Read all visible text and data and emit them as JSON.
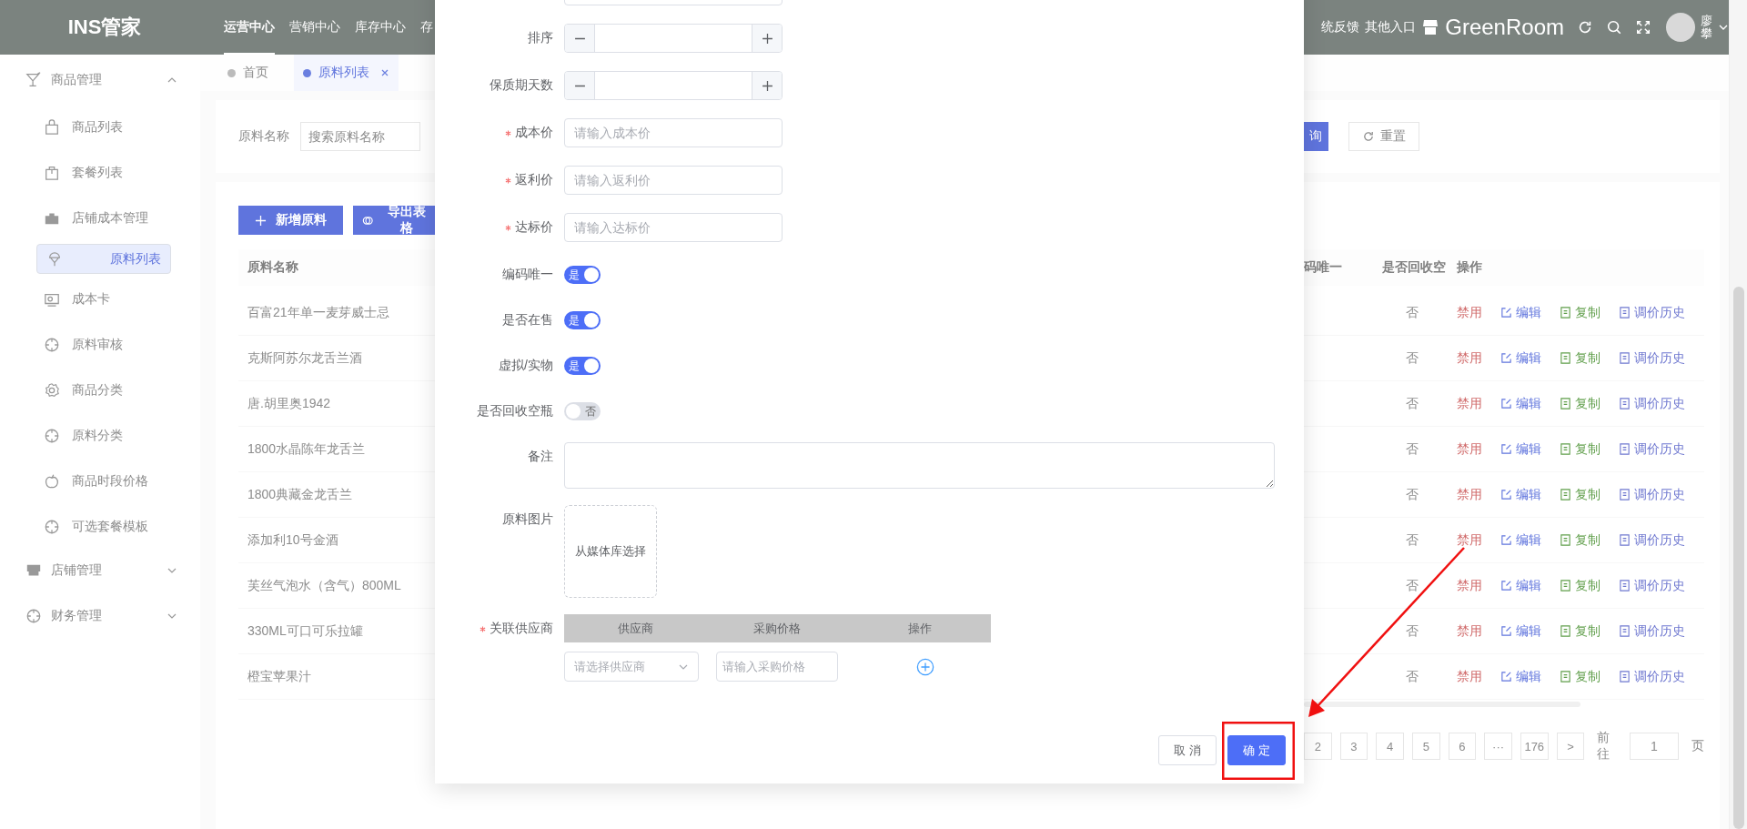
{
  "header": {
    "logo": "INS管家",
    "nav": [
      {
        "label": "运营中心",
        "selected": true
      },
      {
        "label": "营销中心",
        "selected": false
      },
      {
        "label": "库存中心",
        "selected": false
      },
      {
        "label": "存",
        "selected": false
      }
    ],
    "links": [
      "统反馈",
      "其他入口"
    ],
    "brand": "GreenRoom",
    "user": "廖攀"
  },
  "sidebar": {
    "groups": [
      {
        "label": "商品管理",
        "expanded": true,
        "children": [
          {
            "label": "商品列表",
            "selected": false
          },
          {
            "label": "套餐列表",
            "selected": false
          },
          {
            "label": "店铺成本管理",
            "selected": false
          },
          {
            "label": "原料列表",
            "selected": true
          },
          {
            "label": "成本卡",
            "selected": false
          },
          {
            "label": "原料审核",
            "selected": false
          },
          {
            "label": "商品分类",
            "selected": false
          },
          {
            "label": "原料分类",
            "selected": false
          },
          {
            "label": "商品时段价格",
            "selected": false
          },
          {
            "label": "可选套餐模板",
            "selected": false
          }
        ]
      },
      {
        "label": "店铺管理",
        "expanded": false
      },
      {
        "label": "财务管理",
        "expanded": false
      }
    ]
  },
  "tabs": [
    {
      "label": "首页",
      "selected": false,
      "closable": false
    },
    {
      "label": "原料列表",
      "selected": true,
      "closable": true
    }
  ],
  "filter": {
    "label": "原料名称",
    "placeholder": "搜索原料名称",
    "search_button": "询",
    "reset_button": "重置"
  },
  "toolbar": [
    {
      "kind": "add",
      "label": "新增原料"
    },
    {
      "kind": "export",
      "label": "导出表格"
    }
  ],
  "table": {
    "column_1": "原料名称",
    "right_columns": [
      "码唯一",
      "是否回收空",
      "操作"
    ],
    "rows": [
      {
        "name": "百富21年单一麦芽威士忌",
        "recycle": "否",
        "actions": [
          "禁用",
          "编辑",
          "复制",
          "调价历史"
        ]
      },
      {
        "name": "克斯阿苏尔龙舌兰酒",
        "recycle": "否",
        "actions": [
          "禁用",
          "编辑",
          "复制",
          "调价历史"
        ]
      },
      {
        "name": "唐.胡里奥1942",
        "recycle": "否",
        "actions": [
          "禁用",
          "编辑",
          "复制",
          "调价历史"
        ]
      },
      {
        "name": "1800水晶陈年龙舌兰",
        "recycle": "否",
        "actions": [
          "禁用",
          "编辑",
          "复制",
          "调价历史"
        ]
      },
      {
        "name": "1800典藏金龙舌兰",
        "recycle": "否",
        "actions": [
          "禁用",
          "编辑",
          "复制",
          "调价历史"
        ]
      },
      {
        "name": "添加利10号金酒",
        "recycle": "否",
        "actions": [
          "禁用",
          "编辑",
          "复制",
          "调价历史"
        ]
      },
      {
        "name": "芙丝气泡水（含气）800ML",
        "recycle": "否",
        "actions": [
          "禁用",
          "编辑",
          "复制",
          "调价历史"
        ]
      },
      {
        "name": "330ML可口可乐拉罐",
        "recycle": "否",
        "actions": [
          "禁用",
          "编辑",
          "复制",
          "调价历史"
        ]
      },
      {
        "name": "橙宝苹果汁",
        "recycle": "否",
        "actions": [
          "禁用",
          "编辑",
          "复制",
          "调价历史"
        ]
      }
    ]
  },
  "pagination": {
    "pages": [
      "2",
      "3",
      "4",
      "5",
      "6",
      "···",
      "176"
    ],
    "next": ">",
    "goto_label": "前往",
    "goto_value": "1",
    "goto_suffix": "页"
  },
  "dialog": {
    "fields": [
      {
        "kind": "stepper",
        "label": "排序",
        "required": false
      },
      {
        "kind": "stepper",
        "label": "保质期天数",
        "required": false
      },
      {
        "kind": "input",
        "label": "成本价",
        "required": true,
        "placeholder": "请输入成本价"
      },
      {
        "kind": "input",
        "label": "返利价",
        "required": true,
        "placeholder": "请输入返利价"
      },
      {
        "kind": "input",
        "label": "达标价",
        "required": true,
        "placeholder": "请输入达标价"
      },
      {
        "kind": "switch",
        "label": "编码唯一",
        "required": false,
        "on": true,
        "text": "是"
      },
      {
        "kind": "switch",
        "label": "是否在售",
        "required": false,
        "on": true,
        "text": "是"
      },
      {
        "kind": "switch",
        "label": "虚拟/实物",
        "required": false,
        "on": true,
        "text": "是"
      },
      {
        "kind": "switch",
        "label": "是否回收空瓶",
        "required": false,
        "on": false,
        "text": "否"
      },
      {
        "kind": "textarea",
        "label": "备注",
        "required": false
      },
      {
        "kind": "upload",
        "label": "原料图片",
        "required": false,
        "text": "从媒体库选择"
      },
      {
        "kind": "suppliers",
        "label": "关联供应商",
        "required": true,
        "columns": [
          "供应商",
          "采购价格",
          "操作"
        ],
        "select_placeholder": "请选择供应商",
        "price_placeholder": "请输入采购价格"
      }
    ],
    "buttons": [
      {
        "kind": "default",
        "label": "取 消"
      },
      {
        "kind": "primary",
        "label": "确 定"
      }
    ]
  }
}
